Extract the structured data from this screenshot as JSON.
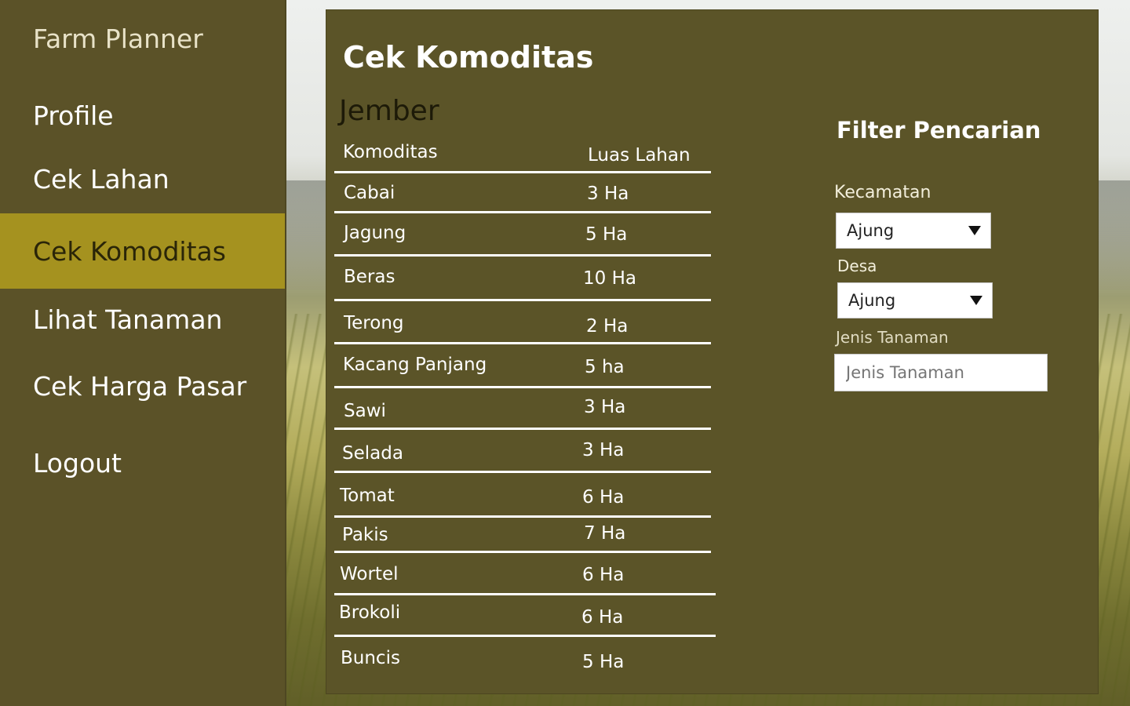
{
  "app": {
    "title": "Farm Planner"
  },
  "sidebar": {
    "items": [
      {
        "label": "Profile"
      },
      {
        "label": "Cek Lahan"
      },
      {
        "label": "Cek Komoditas"
      },
      {
        "label": "Lihat Tanaman"
      },
      {
        "label": "Cek Harga Pasar"
      },
      {
        "label": "Logout"
      }
    ],
    "active": "Cek Komoditas"
  },
  "main": {
    "title": "Cek Komoditas",
    "region": "Jember",
    "table": {
      "headers": [
        "Komoditas",
        "Luas Lahan"
      ],
      "rows": [
        [
          "Cabai",
          "3 Ha"
        ],
        [
          "Jagung",
          "5 Ha"
        ],
        [
          "Beras",
          "10 Ha"
        ],
        [
          "Terong",
          "2 Ha"
        ],
        [
          "Kacang Panjang",
          "5 ha"
        ],
        [
          "Sawi",
          "3 Ha"
        ],
        [
          "Selada",
          "3 Ha"
        ],
        [
          "Tomat",
          "6 Ha"
        ],
        [
          "Pakis",
          "7 Ha"
        ],
        [
          "Wortel",
          "6 Ha"
        ],
        [
          "Brokoli",
          "6 Ha"
        ],
        [
          "Buncis",
          "5 Ha"
        ]
      ]
    }
  },
  "filter": {
    "title": "Filter Pencarian",
    "kecamatan": {
      "label": "Kecamatan",
      "value": "Ajung"
    },
    "desa": {
      "label": "Desa",
      "value": "Ajung"
    },
    "jenis": {
      "label": "Jenis Tanaman",
      "placeholder": "Jenis Tanaman"
    }
  },
  "colors": {
    "sidebar_bg": "#5b5228",
    "active_bg": "#a5921f",
    "panel_bg": "#5b5428"
  },
  "icons": {
    "dropdown": "caret-down-icon"
  }
}
